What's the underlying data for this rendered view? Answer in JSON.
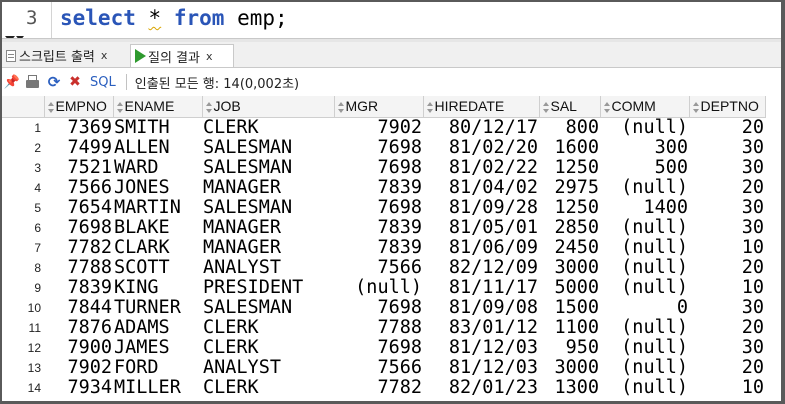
{
  "editor": {
    "line_number": "3",
    "code": {
      "kw_select": "select",
      "star": "*",
      "kw_from": "from",
      "table": "emp;"
    }
  },
  "tabs": [
    {
      "label": "스크립트 출력",
      "close": "x"
    },
    {
      "label": "질의 결과",
      "close": "x"
    }
  ],
  "toolbar": {
    "sql_label": "SQL",
    "status_text": "인출된 모든 행: 14(0,002초)"
  },
  "grid": {
    "columns": [
      "EMPNO",
      "ENAME",
      "JOB",
      "MGR",
      "HIREDATE",
      "SAL",
      "COMM",
      "DEPTNO"
    ],
    "rows": [
      [
        "1",
        "7369",
        "SMITH",
        "CLERK",
        "7902",
        "80/12/17",
        "800",
        "(null)",
        "20"
      ],
      [
        "2",
        "7499",
        "ALLEN",
        "SALESMAN",
        "7698",
        "81/02/20",
        "1600",
        "300",
        "30"
      ],
      [
        "3",
        "7521",
        "WARD",
        "SALESMAN",
        "7698",
        "81/02/22",
        "1250",
        "500",
        "30"
      ],
      [
        "4",
        "7566",
        "JONES",
        "MANAGER",
        "7839",
        "81/04/02",
        "2975",
        "(null)",
        "20"
      ],
      [
        "5",
        "7654",
        "MARTIN",
        "SALESMAN",
        "7698",
        "81/09/28",
        "1250",
        "1400",
        "30"
      ],
      [
        "6",
        "7698",
        "BLAKE",
        "MANAGER",
        "7839",
        "81/05/01",
        "2850",
        "(null)",
        "30"
      ],
      [
        "7",
        "7782",
        "CLARK",
        "MANAGER",
        "7839",
        "81/06/09",
        "2450",
        "(null)",
        "10"
      ],
      [
        "8",
        "7788",
        "SCOTT",
        "ANALYST",
        "7566",
        "82/12/09",
        "3000",
        "(null)",
        "20"
      ],
      [
        "9",
        "7839",
        "KING",
        "PRESIDENT",
        "(null)",
        "81/11/17",
        "5000",
        "(null)",
        "10"
      ],
      [
        "10",
        "7844",
        "TURNER",
        "SALESMAN",
        "7698",
        "81/09/08",
        "1500",
        "0",
        "30"
      ],
      [
        "11",
        "7876",
        "ADAMS",
        "CLERK",
        "7788",
        "83/01/12",
        "1100",
        "(null)",
        "20"
      ],
      [
        "12",
        "7900",
        "JAMES",
        "CLERK",
        "7698",
        "81/12/03",
        "950",
        "(null)",
        "30"
      ],
      [
        "13",
        "7902",
        "FORD",
        "ANALYST",
        "7566",
        "81/12/03",
        "3000",
        "(null)",
        "20"
      ],
      [
        "14",
        "7934",
        "MILLER",
        "CLERK",
        "7782",
        "82/01/23",
        "1300",
        "(null)",
        "10"
      ]
    ]
  },
  "colors": {
    "keyword": "#2a55b7",
    "run_icon": "#2e9a2e",
    "sql_link": "#2b5fbf"
  }
}
